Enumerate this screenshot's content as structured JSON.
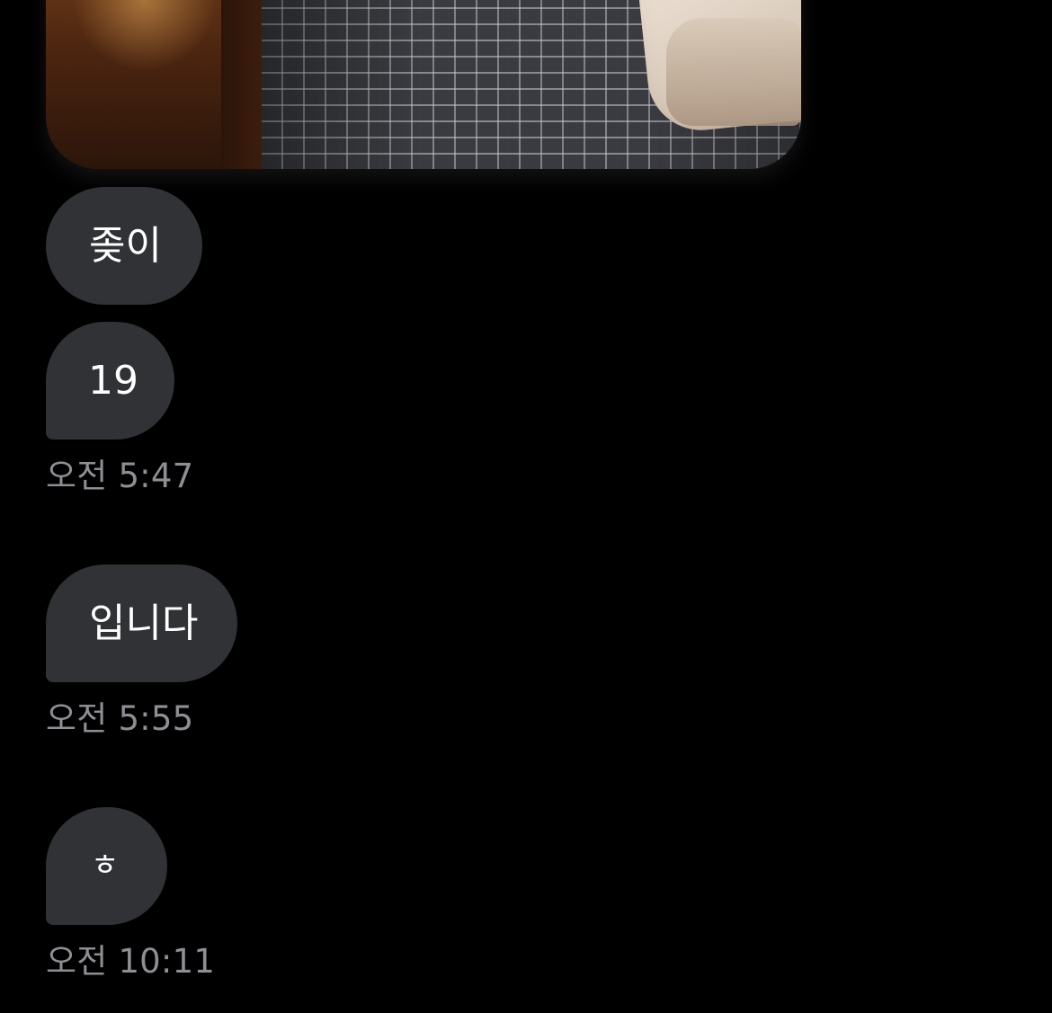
{
  "messages": [
    {
      "kind": "photo",
      "content": "bedroom-photo-carpet-and-bed"
    },
    {
      "kind": "text",
      "text": "좆이"
    },
    {
      "kind": "text",
      "text": "19",
      "time": "오전 5:47"
    },
    {
      "kind": "text",
      "text": "입니다",
      "time": "오전 5:55"
    },
    {
      "kind": "text",
      "text": "ㅎ",
      "time": "오전 10:11"
    }
  ],
  "colors": {
    "background": "#000000",
    "bubble": "#303235",
    "bubble_text": "#ffffff",
    "timestamp": "#8e8e93"
  }
}
